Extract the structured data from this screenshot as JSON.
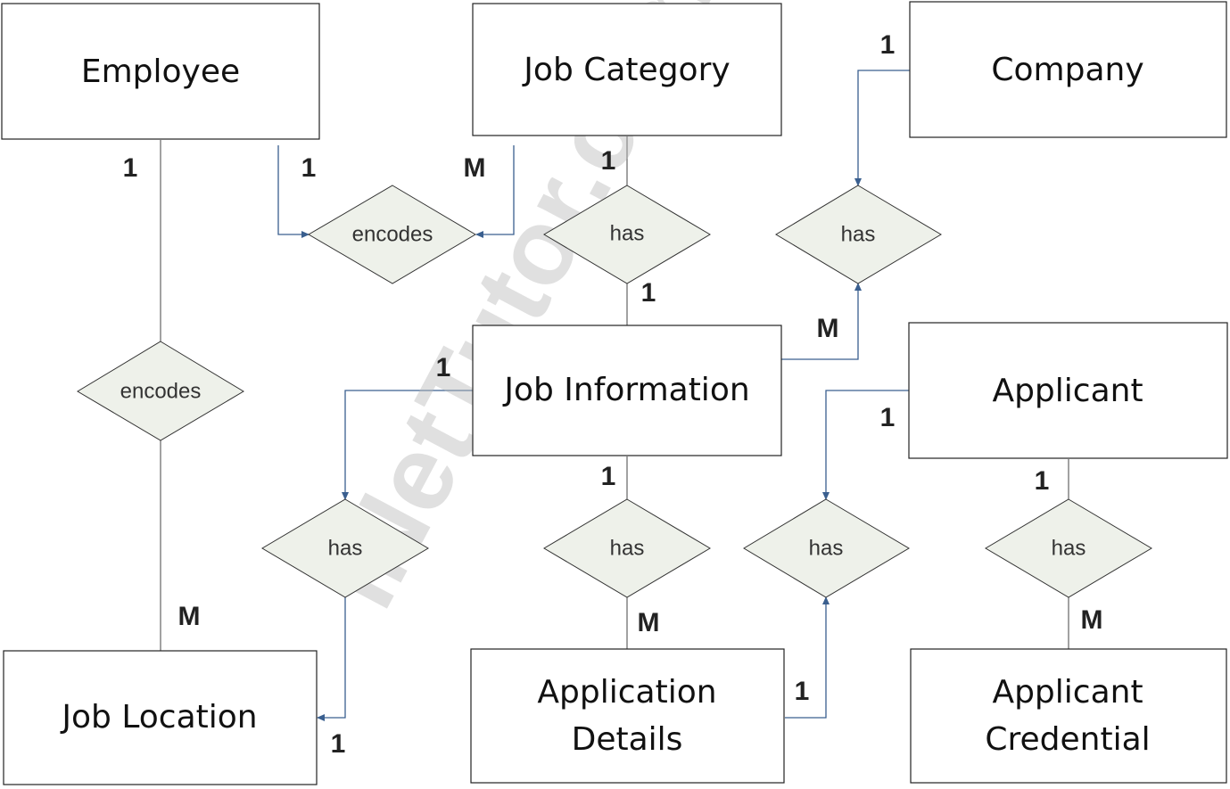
{
  "entities": {
    "employee": "Employee",
    "job_category": "Job Category",
    "company": "Company",
    "job_information": "Job Information",
    "applicant": "Applicant",
    "job_location": "Job Location",
    "application_details_1": "Application",
    "application_details_2": "Details",
    "applicant_credential_1": "Applicant",
    "applicant_credential_2": "Credential"
  },
  "relationships": {
    "r1": "encodes",
    "r2": "has",
    "r3": "has",
    "r4": "encodes",
    "r5": "has",
    "r6": "has",
    "r7": "has",
    "r8": "has"
  },
  "cardinalities": {
    "emp_loc_top": "1",
    "emp_loc_bottom": "M",
    "emp_enc": "1",
    "cat_enc": "M",
    "cat_has": "1",
    "has_info": "1",
    "company_has": "1",
    "info_company": "M",
    "info_loc": "1",
    "loc_end": "1",
    "info_details_top": "1",
    "info_details_bottom": "M",
    "applicant_has": "1",
    "details_has": "1",
    "applicant_cred_top": "1",
    "applicant_cred_bottom": "M"
  },
  "watermark": "iNetTutor.com",
  "colors": {
    "arrow": "#3a5f8f",
    "diamond_fill": "#eef1ea"
  }
}
